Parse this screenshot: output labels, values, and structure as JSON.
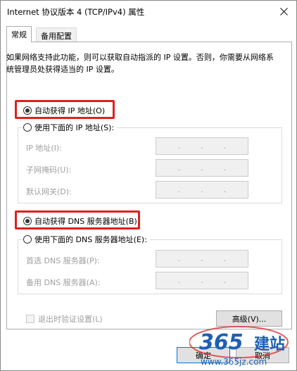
{
  "window": {
    "title": "Internet 协议版本 4 (TCP/IPv4) 属性"
  },
  "tabs": [
    {
      "label": "常规",
      "active": true
    },
    {
      "label": "备用配置",
      "active": false
    }
  ],
  "description": "如果网络支持此功能，则可以获取自动指派的 IP 设置。否则，你需要从网络系统管理员处获得适当的 IP 设置。",
  "ip": {
    "auto_label": "自动获得 IP 地址(O)",
    "auto_selected": true,
    "manual_label": "使用下面的 IP 地址(S):",
    "fields": [
      {
        "label": "IP 地址(I):",
        "value": ".   .   ."
      },
      {
        "label": "子网掩码(U):",
        "value": ".   .   ."
      },
      {
        "label": "默认网关(D):",
        "value": ".   .   ."
      }
    ]
  },
  "dns": {
    "auto_label": "自动获得 DNS 服务器地址(B)",
    "auto_selected": true,
    "manual_label": "使用下面的 DNS 服务器地址(E):",
    "fields": [
      {
        "label": "首选 DNS 服务器(P):",
        "value": ".   .   ."
      },
      {
        "label": "备用 DNS 服务器(A):",
        "value": ".   .   ."
      }
    ]
  },
  "validate_label": "退出时验证设置(L)",
  "buttons": {
    "advanced": "高级(V)...",
    "ok": "确定",
    "cancel": "取消"
  },
  "watermark": {
    "logo": "365",
    "cn": "建站",
    "url": "www.365jz.com"
  },
  "colors": {
    "highlight": "#e02020",
    "disabled_text": "#a0a0a0",
    "accent": "#0078d7"
  }
}
